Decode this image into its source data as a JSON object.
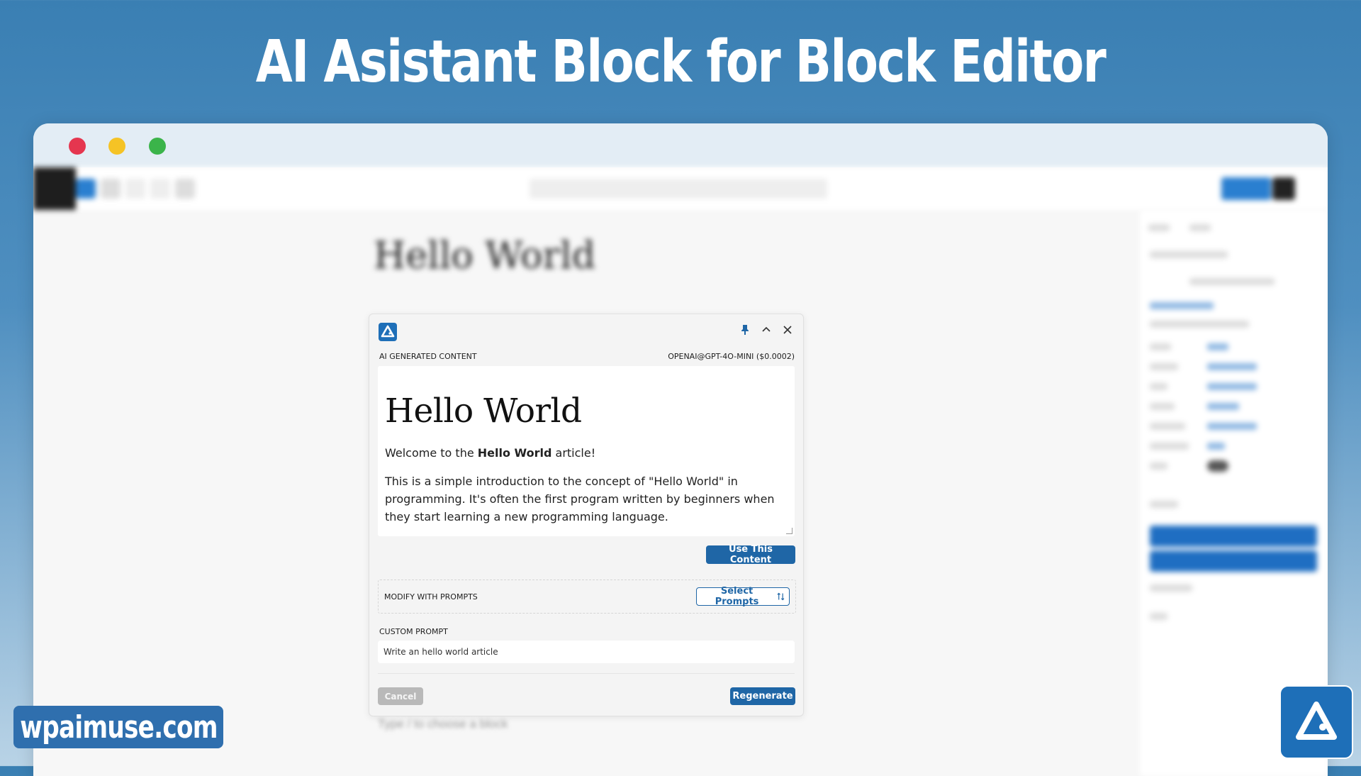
{
  "hero": {
    "title": "AI Asistant Block for Block Editor"
  },
  "editor": {
    "background_title": "Hello World",
    "block_placeholder": "Type / to choose a block"
  },
  "ai_panel": {
    "header": {
      "logo_icon": "plugin-logo-icon",
      "pin_icon": "pin-icon",
      "collapse_icon": "chevron-up-icon",
      "close_icon": "close-icon"
    },
    "generated_label": "AI GENERATED CONTENT",
    "model_label": "OPENAI@GPT-4O-MINI ($0.0002)",
    "content": {
      "heading": "Hello World",
      "p1_before": "Welcome to the ",
      "p1_bold": "Hello World",
      "p1_after": " article!",
      "p2": "This is a simple introduction to the concept of \"Hello World\" in programming. It's often the first program written by beginners when they start learning a new programming language."
    },
    "use_content_label": "Use This Content",
    "modify_label": "MODIFY WITH PROMPTS",
    "select_prompts_label": "Select Prompts",
    "custom_prompt_label": "CUSTOM PROMPT",
    "custom_prompt_value": "Write an hello world article",
    "cancel_label": "Cancel",
    "regenerate_label": "Regenerate"
  },
  "footer": {
    "site": "wpaimuse.com"
  },
  "colors": {
    "accent": "#1f66a6",
    "brand": "#1e6fb8",
    "window_red": "#e5364f",
    "window_yellow": "#f5c325",
    "window_green": "#3bb44a"
  }
}
